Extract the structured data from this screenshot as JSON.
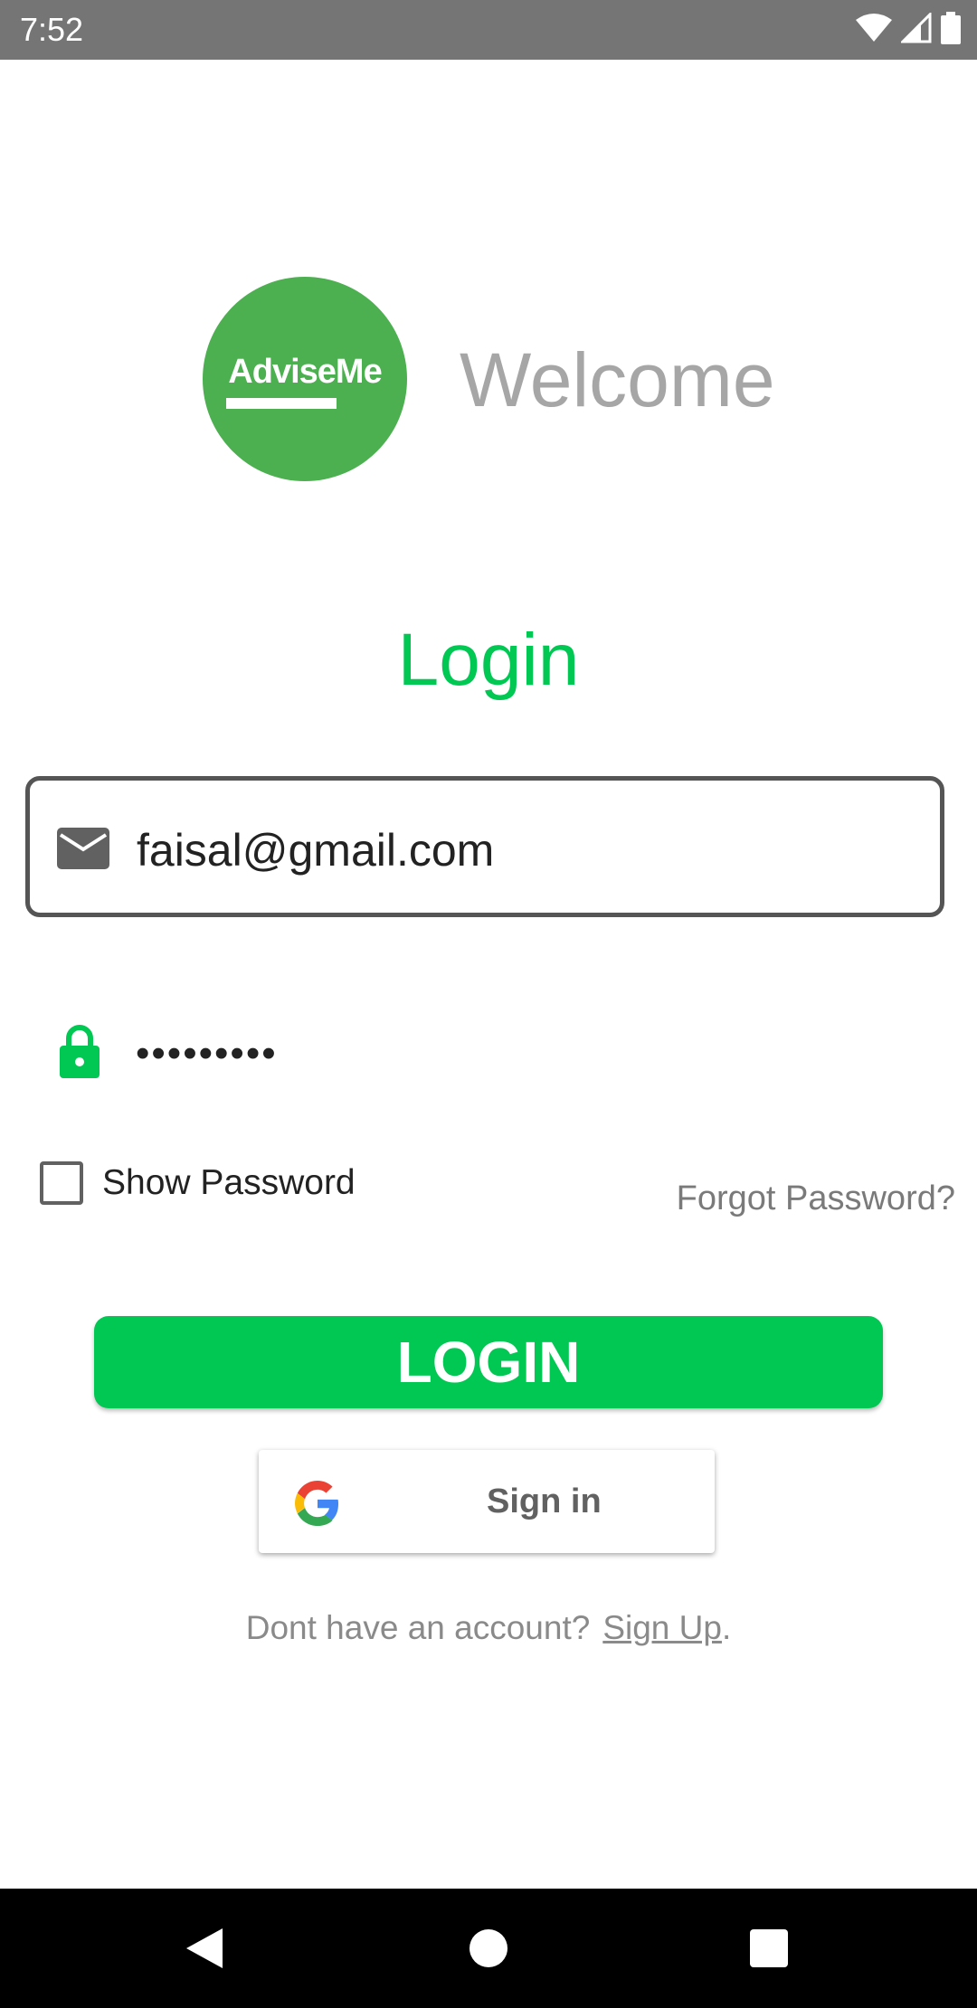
{
  "status_bar": {
    "time": "7:52",
    "icons": [
      "wifi-icon",
      "cellular-signal-icon",
      "battery-icon"
    ]
  },
  "logo": {
    "text": "AdviseMe",
    "color": "#4caf50"
  },
  "header": {
    "welcome": "Welcome"
  },
  "form": {
    "title": "Login",
    "email": {
      "value": "faisal@gmail.com",
      "icon": "mail-icon"
    },
    "password": {
      "value": "•••••••••",
      "icon": "lock-icon"
    },
    "show_password": {
      "label": "Show Password",
      "checked": false
    },
    "forgot_password": "Forgot Password?",
    "login_button": "LOGIN",
    "google_button": "Sign in"
  },
  "footer": {
    "prompt": "Dont have an account?",
    "signup_link": "Sign Up",
    "period": "."
  },
  "colors": {
    "accent": "#00c853",
    "status_bar": "#757575",
    "nav_bar": "#000000"
  },
  "nav_bar": {
    "buttons": [
      "back-icon",
      "home-icon",
      "recents-icon"
    ]
  }
}
